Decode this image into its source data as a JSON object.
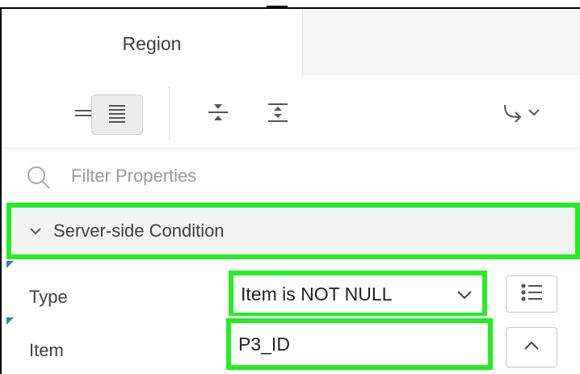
{
  "tabs": [
    {
      "label": "Region",
      "active": true
    }
  ],
  "toolbar": {
    "buttons": [
      {
        "name": "show-common-button",
        "icon": "show-common-icon",
        "active": false
      },
      {
        "name": "show-all-button",
        "icon": "show-all-icon",
        "active": true
      },
      {
        "name": "collapse-all-button",
        "icon": "collapse-all-icon",
        "active": false
      },
      {
        "name": "expand-all-button",
        "icon": "expand-all-icon",
        "active": false
      },
      {
        "name": "go-to-group-button",
        "icon": "go-to-group-icon",
        "active": false
      }
    ]
  },
  "filter": {
    "placeholder": "Filter Properties",
    "value": ""
  },
  "group": {
    "title": "Server-side Condition",
    "expanded": true
  },
  "properties": [
    {
      "label": "Type",
      "value": "Item is NOT NULL",
      "control": "select",
      "side_icon": "list-icon"
    },
    {
      "label": "Item",
      "value": "P3_ID",
      "control": "text",
      "side_icon": "chevron-up-icon"
    }
  ],
  "colors": {
    "highlight": "#22ee22",
    "active_button_bg": "#ececec",
    "changed_marker": "#3a78c8"
  }
}
